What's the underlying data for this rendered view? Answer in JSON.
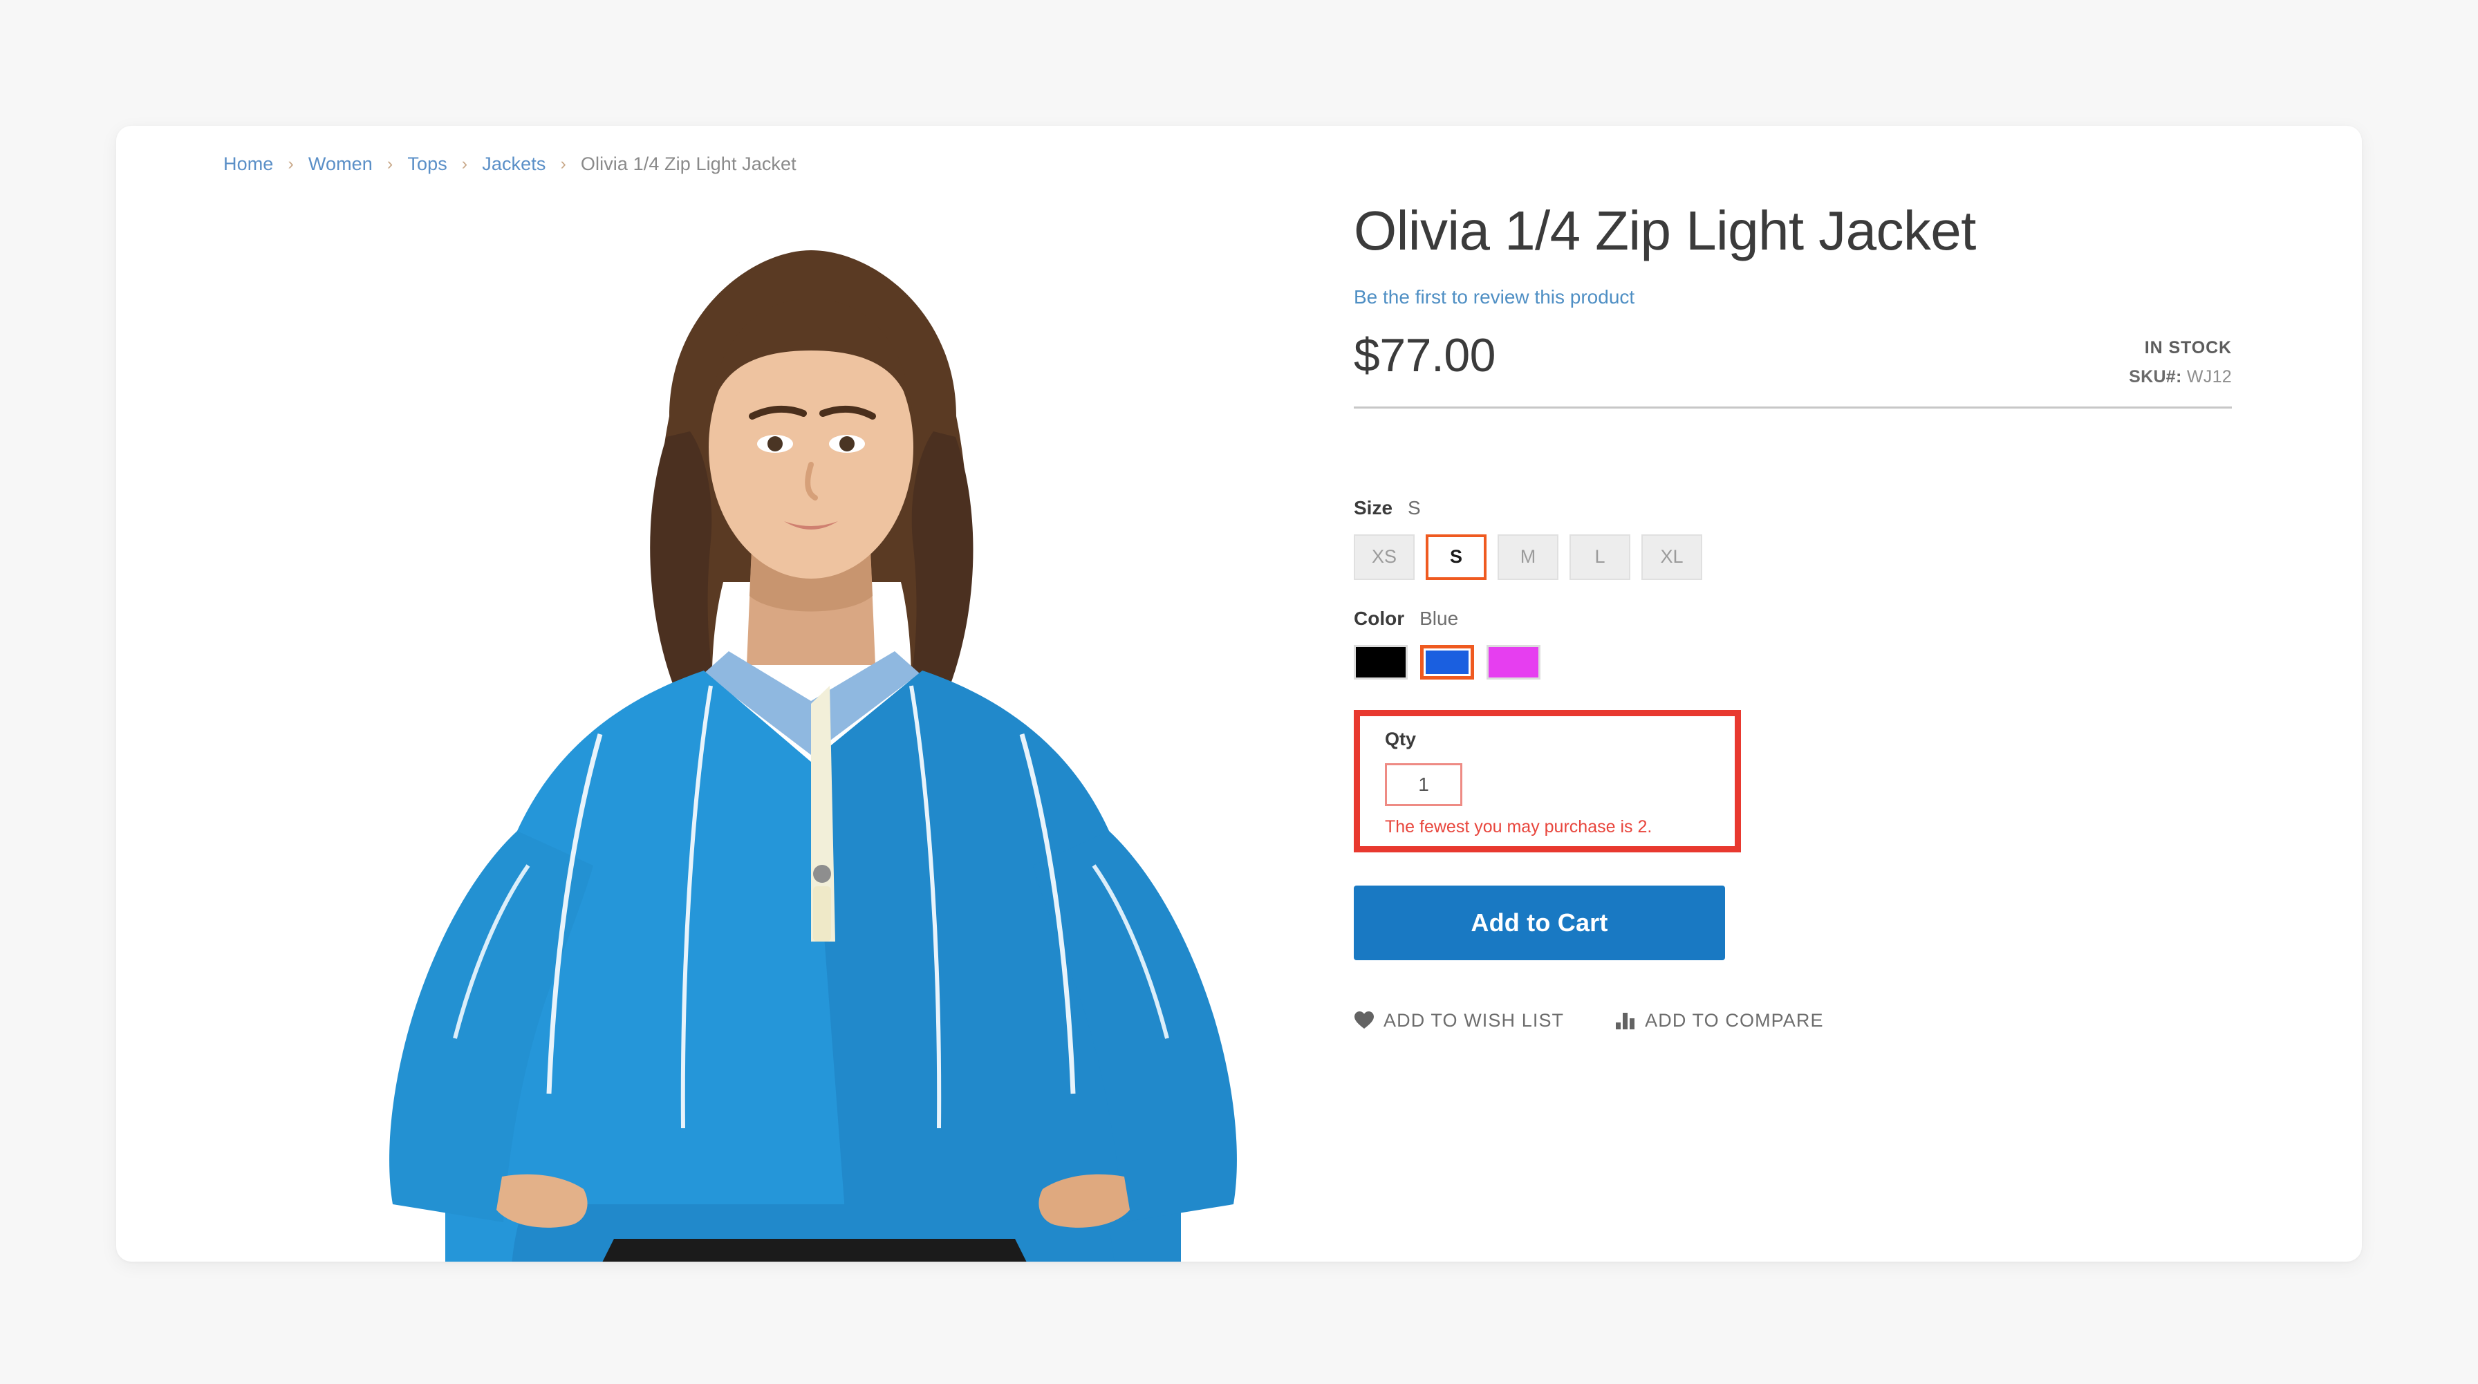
{
  "breadcrumb": {
    "separator": "›",
    "items": [
      {
        "label": "Home",
        "current": false
      },
      {
        "label": "Women",
        "current": false
      },
      {
        "label": "Tops",
        "current": false
      },
      {
        "label": "Jackets",
        "current": false
      },
      {
        "label": "Olivia 1/4 Zip Light Jacket",
        "current": true
      }
    ]
  },
  "product": {
    "title": "Olivia 1/4 Zip Light Jacket",
    "review_link": "Be the first to review this product",
    "price": "$77.00",
    "stock_status": "IN STOCK",
    "sku_label": "SKU#:",
    "sku_value": "WJ12",
    "image_alt": "Model wearing blue quarter-zip light jacket"
  },
  "options": {
    "size": {
      "label": "Size",
      "selected": "S",
      "values": [
        "XS",
        "S",
        "M",
        "L",
        "XL"
      ]
    },
    "color": {
      "label": "Color",
      "selected": "Blue",
      "values": [
        {
          "name": "Black",
          "hex": "#000000",
          "selected": false
        },
        {
          "name": "Blue",
          "hex": "#1a5fe0",
          "selected": true
        },
        {
          "name": "Purple",
          "hex": "#e63ef0",
          "selected": false
        }
      ]
    }
  },
  "qty": {
    "label": "Qty",
    "value": "1",
    "error": "The fewest you may purchase is 2.",
    "highlight_color": "#e8392f"
  },
  "actions": {
    "add_to_cart": "Add to Cart",
    "wish_list": "ADD TO WISH LIST",
    "compare": "ADD TO COMPARE"
  },
  "colors": {
    "accent_blue": "#1979c3",
    "selected_orange": "#ef5a20",
    "error_red": "#e8453c",
    "link_blue": "#5a8fc7"
  }
}
